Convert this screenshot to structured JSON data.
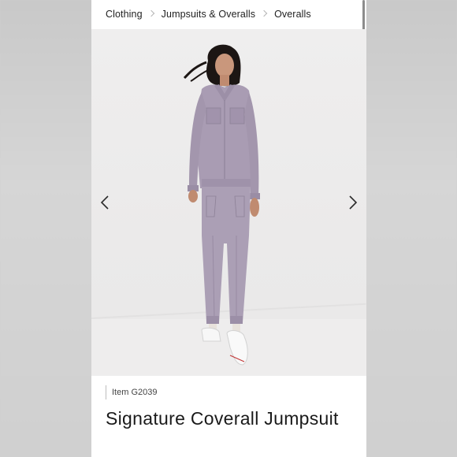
{
  "breadcrumb": {
    "items": [
      "Clothing",
      "Jumpsuits & Overalls",
      "Overalls"
    ]
  },
  "product": {
    "item_number": "Item G2039",
    "title": "Signature Coverall Jumpsuit"
  },
  "gallery": {
    "prev_icon": "chevron-left-icon",
    "next_icon": "chevron-right-icon"
  },
  "colors": {
    "jumpsuit": "#a99cb3",
    "background": "#efeeee",
    "text": "#1a1a1a"
  }
}
